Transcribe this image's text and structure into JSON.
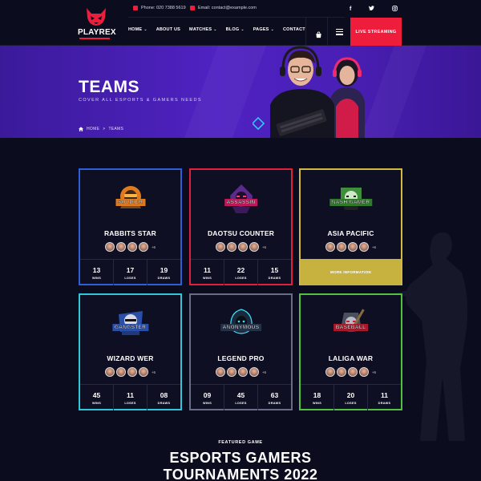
{
  "brand": {
    "name": "PLAYREX",
    "accent": "#ee1d3c"
  },
  "topbar": {
    "phone": "Phone: 020 7388 5619",
    "email": "Email: contact@example.com"
  },
  "social": [
    "f",
    "t",
    "ig"
  ],
  "nav": {
    "items": [
      {
        "label": "HOME",
        "dropdown": true
      },
      {
        "label": "ABOUT US",
        "dropdown": false
      },
      {
        "label": "MATCHES",
        "dropdown": true
      },
      {
        "label": "BLOG",
        "dropdown": true
      },
      {
        "label": "PAGES",
        "dropdown": true
      },
      {
        "label": "CONTACT",
        "dropdown": false
      }
    ],
    "live_label": "LIVE STREAMING"
  },
  "hero": {
    "title": "TEAMS",
    "subtitle": "COVER ALL ESPORTS & GAMERS NEEDS",
    "breadcrumb": {
      "home": "HOME",
      "sep": ">",
      "current": "TEAMS"
    }
  },
  "teams": [
    {
      "mascot": "SOLDIER",
      "name": "RABBITS STAR",
      "border": "#2f5fd6",
      "more": "+6",
      "stats": [
        {
          "value": "13",
          "label": "WINS"
        },
        {
          "value": "17",
          "label": "LOSES"
        },
        {
          "value": "19",
          "label": "DRAWS"
        }
      ]
    },
    {
      "mascot": "ASSASSIN",
      "name": "DAOTSU COUNTER",
      "border": "#e21f3c",
      "more": "+6",
      "stats": [
        {
          "value": "11",
          "label": "WINS"
        },
        {
          "value": "22",
          "label": "LOSES"
        },
        {
          "value": "15",
          "label": "DRAWS"
        }
      ]
    },
    {
      "mascot": "NASH GAMER",
      "name": "ASIA PACIFIC",
      "border": "#d2b93f",
      "more": "+6",
      "more_info": "MORE INFORMATION"
    },
    {
      "mascot": "GANGSTER",
      "name": "WIZARD WER",
      "border": "#31c7d8",
      "more": "+6",
      "stats": [
        {
          "value": "45",
          "label": "WINS"
        },
        {
          "value": "11",
          "label": "LOSES"
        },
        {
          "value": "08",
          "label": "DRAWS"
        }
      ]
    },
    {
      "mascot": "ANONYMOUS",
      "name": "LEGEND PRO",
      "border": "#6a6d86",
      "more": "+6",
      "stats": [
        {
          "value": "09",
          "label": "WINS"
        },
        {
          "value": "45",
          "label": "LOSES"
        },
        {
          "value": "63",
          "label": "DRAWS"
        }
      ]
    },
    {
      "mascot": "BASEBALL",
      "name": "LALIGA WAR",
      "border": "#52c043",
      "more": "+6",
      "stats": [
        {
          "value": "18",
          "label": "WINS"
        },
        {
          "value": "20",
          "label": "LOSES"
        },
        {
          "value": "11",
          "label": "DRAWS"
        }
      ]
    }
  ],
  "featured": {
    "eyebrow": "FEATURED GAME",
    "title_line1": "ESPORTS GAMERS",
    "title_line2": "TOURNAMENTS 2022"
  }
}
